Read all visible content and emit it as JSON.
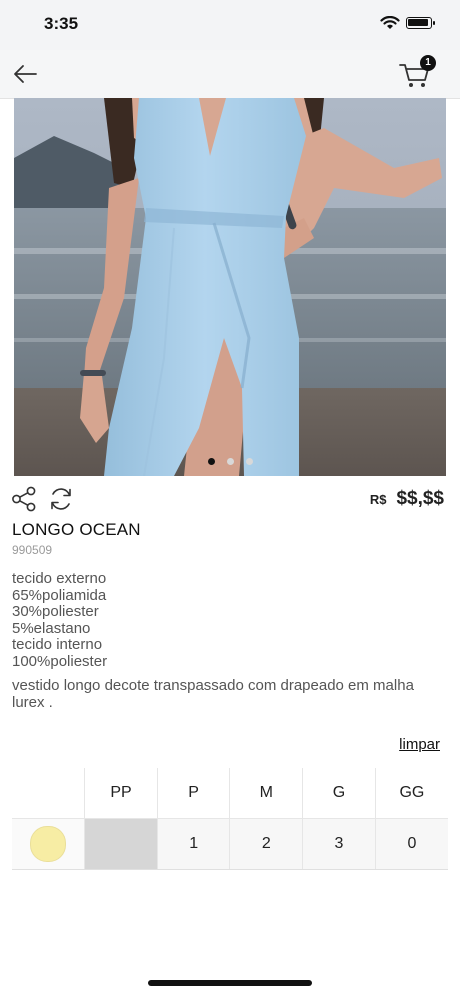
{
  "status_bar": {
    "time": "3:35"
  },
  "nav": {
    "cart_count": "1",
    "icons": [
      "back-arrow-icon",
      "cart-icon"
    ]
  },
  "gallery": {
    "slides": 3,
    "active_index": 0
  },
  "product": {
    "price_currency": "R$",
    "price_value": "$$,$$",
    "name": "LONGO OCEAN",
    "code": "990509",
    "composition": [
      "tecido externo",
      "65%poliamida",
      "30%poliester",
      "5%elastano",
      "tecido interno",
      "100%poliester"
    ],
    "description": "vestido longo decote transpassado com drapeado em malha lurex ."
  },
  "grid": {
    "clear_label": "limpar",
    "sizes": [
      "PP",
      "P",
      "M",
      "G",
      "GG"
    ],
    "rows": [
      {
        "color": "#f7eda4",
        "quantities": [
          "",
          "1",
          "2",
          "3",
          "0"
        ],
        "available": [
          false,
          true,
          true,
          true,
          true
        ]
      }
    ]
  },
  "colors": {
    "accent": "#111111",
    "unavailable_cell": "#d6d6d6",
    "dress": "#a9cde7"
  }
}
